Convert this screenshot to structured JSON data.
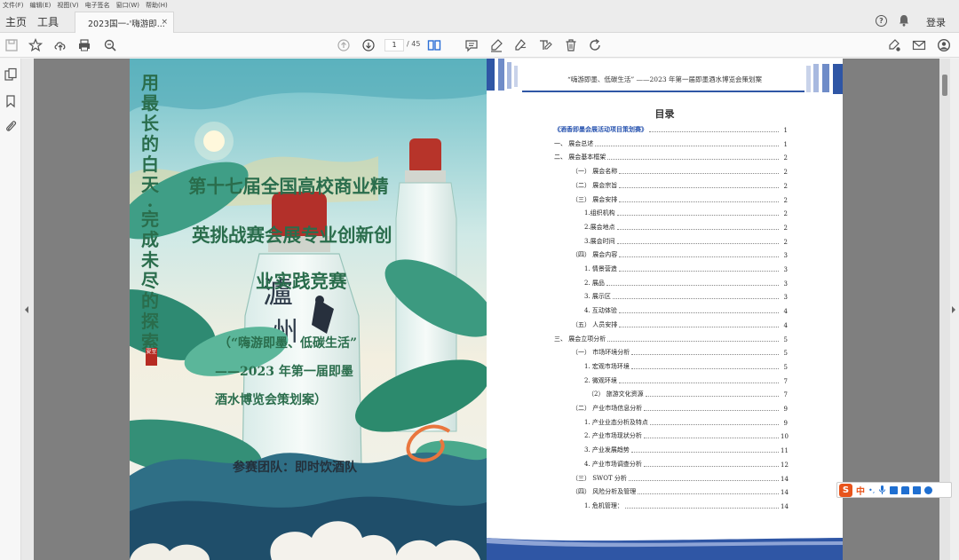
{
  "menu": [
    "文件(F)",
    "编辑(E)",
    "视图(V)",
    "电子签名",
    "窗口(W)",
    "帮助(H)"
  ],
  "tabs": {
    "home": "主页",
    "tools": "工具",
    "document": "2023国一-'嗨游即...",
    "close": "×"
  },
  "header_right": {
    "help": "?",
    "login": "登录"
  },
  "toolbar": {
    "current_page": "1",
    "total_pages": "/ 45"
  },
  "cover": {
    "vertical_1": [
      "用",
      "最",
      "长",
      "的",
      "白",
      "天",
      "·"
    ],
    "vertical_2": [
      "完",
      "成",
      "未",
      "尽",
      "的",
      "探",
      "索"
    ],
    "seal": "夏至",
    "title_line_1": "第十七届全国高校商业精",
    "title_line_2": "英挑战赛会展专业创新创",
    "title_line_3": "业实践竞赛",
    "subtitle_1": "（“嗨游即墨、低碳生活”",
    "subtitle_2": "——2023 年第一届即墨",
    "subtitle_3": "酒水博览会策划案）",
    "team": "参赛团队：即时饮酒队"
  },
  "toc_page": {
    "header": "“嗨游即墨、低碳生活” ——2023 年第一届即墨酒水博览会策划案",
    "title": "目录",
    "entries": [
      {
        "text": "《酒香即墨会展活动项目策划赛》",
        "page": "1",
        "level": 0,
        "highlight": true
      },
      {
        "text": "一、  展会总述",
        "page": "1",
        "level": 0
      },
      {
        "text": "二、  展会基本框架",
        "page": "2",
        "level": 0
      },
      {
        "text": "（一）  展会名称",
        "page": "2",
        "level": 1
      },
      {
        "text": "（二）  展会宗旨",
        "page": "2",
        "level": 1
      },
      {
        "text": "（三）  展会安排",
        "page": "2",
        "level": 1
      },
      {
        "text": "1.组织机构",
        "page": "2",
        "level": 2
      },
      {
        "text": "2.展会地点",
        "page": "2",
        "level": 2
      },
      {
        "text": "3.展会时间",
        "page": "2",
        "level": 2
      },
      {
        "text": "（四）  展会内容",
        "page": "3",
        "level": 1
      },
      {
        "text": "1.    情景营造",
        "page": "3",
        "level": 2
      },
      {
        "text": "2.    展品",
        "page": "3",
        "level": 2
      },
      {
        "text": "3.    展示区",
        "page": "3",
        "level": 2
      },
      {
        "text": "4.    互动体验",
        "page": "4",
        "level": 2
      },
      {
        "text": "（五）  人员安排",
        "page": "4",
        "level": 1
      },
      {
        "text": "三、  展会立项分析",
        "page": "5",
        "level": 0
      },
      {
        "text": "（一）  市场环境分析",
        "page": "5",
        "level": 1
      },
      {
        "text": "1.    宏观市场环境",
        "page": "5",
        "level": 2
      },
      {
        "text": "2.    微观环境",
        "page": "7",
        "level": 2
      },
      {
        "text": "（2）  旅游文化资源",
        "page": "7",
        "level": 3
      },
      {
        "text": "（二）  产业市场信息分析",
        "page": "9",
        "level": 1
      },
      {
        "text": "1.    产业业态分析及特点",
        "page": "9",
        "level": 2
      },
      {
        "text": "2.    产业市场现状分析",
        "page": "10",
        "level": 2
      },
      {
        "text": "3.    产业发展趋势",
        "page": "11",
        "level": 2
      },
      {
        "text": "4.    产业市场调查分析",
        "page": "12",
        "level": 2
      },
      {
        "text": "（三）  SWOT 分析",
        "page": "14",
        "level": 1
      },
      {
        "text": "（四）  风险分析及管理",
        "page": "14",
        "level": 1
      },
      {
        "text": "1.    危机管理：",
        "page": "14",
        "level": 2
      }
    ]
  },
  "ime": {
    "logo": "S",
    "mode": "中",
    "punct": "•,"
  },
  "colors": {
    "accent_blue": "#2f56a5",
    "toc_link": "#2a55b0",
    "title_green": "#2a6d4c"
  }
}
